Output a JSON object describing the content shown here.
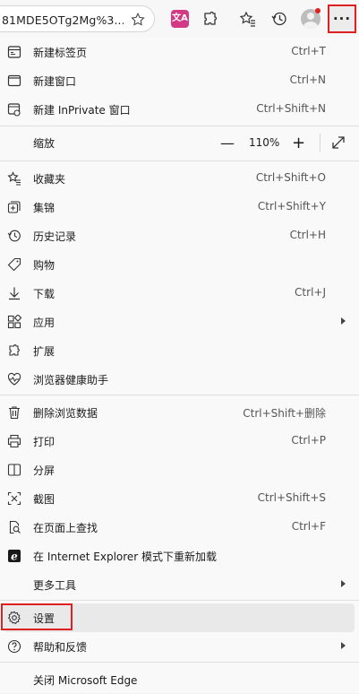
{
  "toolbar": {
    "address_text": "81MDE5OTg2Mg%3...",
    "ext_badge": "文A",
    "more_label": "···",
    "icons": [
      "favorite-star-icon",
      "translate-extension-icon",
      "extensions-puzzle-icon",
      "favorites-icon",
      "history-icon",
      "profile-avatar",
      "more-menu-icon"
    ]
  },
  "menu": {
    "new_tab": {
      "label": "新建标签页",
      "shortcut": "Ctrl+T"
    },
    "new_window": {
      "label": "新建窗口",
      "shortcut": "Ctrl+N"
    },
    "new_inprivate": {
      "label": "新建 InPrivate 窗口",
      "shortcut": "Ctrl+Shift+N"
    },
    "zoom": {
      "label": "缩放",
      "minus": "—",
      "value": "110%",
      "plus": "+"
    },
    "favorites": {
      "label": "收藏夹",
      "shortcut": "Ctrl+Shift+O"
    },
    "collections": {
      "label": "集锦",
      "shortcut": "Ctrl+Shift+Y"
    },
    "history": {
      "label": "历史记录",
      "shortcut": "Ctrl+H"
    },
    "shopping": {
      "label": "购物",
      "shortcut": ""
    },
    "downloads": {
      "label": "下载",
      "shortcut": "Ctrl+J"
    },
    "apps": {
      "label": "应用",
      "shortcut": ""
    },
    "extensions": {
      "label": "扩展",
      "shortcut": ""
    },
    "browser_health": {
      "label": "浏览器健康助手",
      "shortcut": ""
    },
    "clear_data": {
      "label": "删除浏览数据",
      "shortcut": "Ctrl+Shift+删除"
    },
    "print": {
      "label": "打印",
      "shortcut": "Ctrl+P"
    },
    "split_screen": {
      "label": "分屏",
      "shortcut": ""
    },
    "screenshot": {
      "label": "截图",
      "shortcut": "Ctrl+Shift+S"
    },
    "find": {
      "label": "在页面上查找",
      "shortcut": "Ctrl+F"
    },
    "ie_mode": {
      "label": "在 Internet Explorer 模式下重新加载",
      "shortcut": ""
    },
    "more_tools": {
      "label": "更多工具",
      "shortcut": ""
    },
    "settings": {
      "label": "设置",
      "shortcut": ""
    },
    "help": {
      "label": "帮助和反馈",
      "shortcut": ""
    },
    "close_edge": {
      "label": "关闭 Microsoft Edge",
      "shortcut": ""
    }
  },
  "colors": {
    "highlight": "#e02020",
    "menu_bg": "#f9f9f9",
    "hover": "#e9e9e9"
  }
}
